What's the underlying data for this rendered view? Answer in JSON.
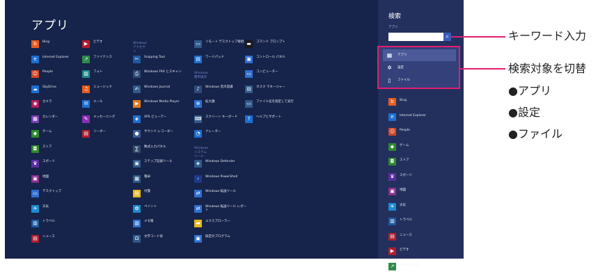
{
  "screen": {
    "title": "アプリ"
  },
  "columns": [
    [
      {
        "label": "Bing",
        "color": "#e65c1e",
        "icon": "b"
      },
      {
        "label": "Internet Explorer",
        "color": "#1e6fd0",
        "icon": "e"
      },
      {
        "label": "People",
        "color": "#d24726",
        "icon": "☺"
      },
      {
        "label": "SkyDrive",
        "color": "#1e6fd0",
        "icon": "☁"
      },
      {
        "label": "カメラ",
        "color": "#b01e5a",
        "icon": "◉"
      },
      {
        "label": "カレンダー",
        "color": "#7a3fb5",
        "icon": "▦"
      },
      {
        "label": "ゲーム",
        "color": "#2f8a2f",
        "icon": "◆"
      },
      {
        "label": "ストア",
        "color": "#2f8a2f",
        "icon": "◘"
      },
      {
        "label": "スポーツ",
        "color": "#5b2fa0",
        "icon": "♛"
      },
      {
        "label": "地図",
        "color": "#8a2f8a",
        "icon": "▣"
      },
      {
        "label": "デスクトップ",
        "color": "#2f6fd0",
        "icon": "▭"
      },
      {
        "label": "天気",
        "color": "#1e8ad0",
        "icon": "☀"
      },
      {
        "label": "トラベル",
        "color": "#1e5aa0",
        "icon": "▥"
      },
      {
        "label": "ニュース",
        "color": "#b01e2f",
        "icon": "▤"
      }
    ],
    [
      {
        "label": "ビデオ",
        "color": "#b01e2f",
        "icon": "▶"
      },
      {
        "label": "ファイナンス",
        "color": "#2f8a4a",
        "icon": "↗"
      },
      {
        "label": "フォト",
        "color": "#1e8a8a",
        "icon": "▨"
      },
      {
        "label": "ミュージック",
        "color": "#e65c1e",
        "icon": "♫"
      },
      {
        "label": "メール",
        "color": "#1e6fd0",
        "icon": "✉"
      },
      {
        "label": "メッセージング",
        "color": "#8a2fb0",
        "icon": "✎"
      },
      {
        "label": "リーダー",
        "color": "#b01e2f",
        "icon": "▤"
      }
    ],
    [
      {
        "header": "Windows アクセサリ"
      },
      {
        "label": "Snipping Tool",
        "color": "#1e5aa0",
        "icon": "✂"
      },
      {
        "label": "Windows FAX とスキャン",
        "color": "#2f4a7a",
        "icon": "⎙"
      },
      {
        "label": "Windows Journal",
        "color": "#2f5a8a",
        "icon": "✍"
      },
      {
        "label": "Windows Media Player",
        "color": "#e67a1e",
        "icon": "▶"
      },
      {
        "label": "XPS ビューアー",
        "color": "#1e6fd0",
        "icon": "◈"
      },
      {
        "label": "サウンド レコーダー",
        "color": "#3a5a9a",
        "icon": "●"
      },
      {
        "label": "数式入力パネル",
        "color": "#2f4a6a",
        "icon": "∑"
      },
      {
        "label": "ステップ記録ツール",
        "color": "#2f5a8a",
        "icon": "▣"
      },
      {
        "label": "電卓",
        "color": "#2f5a8a",
        "icon": "▦"
      },
      {
        "label": "付箋",
        "color": "#e6b81e",
        "icon": "▤"
      },
      {
        "label": "ペイント",
        "color": "#1e8ad0",
        "icon": "✿"
      },
      {
        "label": "メモ帳",
        "color": "#2f6fd0",
        "icon": "▥"
      },
      {
        "label": "文字コード表",
        "color": "#2f5a8a",
        "icon": "Ω"
      }
    ],
    [
      {
        "label": "リモート デスクトップ接続",
        "color": "#2f5a8a",
        "icon": "▭"
      },
      {
        "label": "ワードパッド",
        "color": "#1e6fd0",
        "icon": "▤"
      },
      {
        "header": "Windows 簡単操作"
      },
      {
        "label": "Windows 音声認識",
        "color": "#2f4a7a",
        "icon": "♪"
      },
      {
        "label": "拡大鏡",
        "color": "#2f6fd0",
        "icon": "⊕"
      },
      {
        "label": "スクリーン キーボード",
        "color": "#2f5a8a",
        "icon": "⌨"
      },
      {
        "label": "ナレーター",
        "color": "#1e6fd0",
        "icon": "◔"
      },
      {
        "header": "Windows システム ツール"
      },
      {
        "label": "Windows Defender",
        "color": "#2f5a8a",
        "icon": "◈"
      },
      {
        "label": "Windows PowerShell",
        "color": "#1e3a8a",
        "icon": "›"
      },
      {
        "label": "Windows 転送ツール",
        "color": "#2f6fd0",
        "icon": "⇄"
      },
      {
        "label": "Windows 転送ツール レポート",
        "color": "#2f6fd0",
        "icon": "⇄"
      },
      {
        "label": "エクスプローラー",
        "color": "#e6b81e",
        "icon": "▬"
      },
      {
        "label": "既定のプログラム",
        "color": "#2f6fd0",
        "icon": "▣"
      }
    ],
    [
      {
        "label": "コマンド プロンプト",
        "color": "#1a1a1a",
        "icon": "▬"
      },
      {
        "label": "コントロール パネル",
        "color": "#2f6fd0",
        "icon": "▣"
      },
      {
        "label": "コンピューター",
        "color": "#2f6fd0",
        "icon": "▭"
      },
      {
        "label": "タスク マネージャー",
        "color": "#2f5a8a",
        "icon": "▤"
      },
      {
        "label": "ファイル名を指定して実行",
        "color": "#2f5a8a",
        "icon": "▭"
      },
      {
        "label": "ヘルプとサポート",
        "color": "#1e6fd0",
        "icon": "?"
      }
    ]
  ],
  "charm": {
    "title": "検索",
    "scope": "アプリ",
    "search_value": "",
    "search_button_icon": "magnifier-icon",
    "filters": [
      {
        "label": "アプリ",
        "icon": "grid-icon",
        "selected": true
      },
      {
        "label": "設定",
        "icon": "gear-icon",
        "selected": false
      },
      {
        "label": "ファイル",
        "icon": "file-icon",
        "selected": false
      }
    ],
    "apps": [
      {
        "label": "Bing",
        "color": "#e65c1e",
        "icon": "b"
      },
      {
        "label": "Internet Explorer",
        "color": "#1e6fd0",
        "icon": "e"
      },
      {
        "label": "People",
        "color": "#d24726",
        "icon": "☺"
      },
      {
        "label": "ゲーム",
        "color": "#2f8a2f",
        "icon": "◆"
      },
      {
        "label": "ストア",
        "color": "#2f8a2f",
        "icon": "◘"
      },
      {
        "label": "スポーツ",
        "color": "#5b2fa0",
        "icon": "♛"
      },
      {
        "label": "地図",
        "color": "#8a2f8a",
        "icon": "▣"
      },
      {
        "label": "天気",
        "color": "#1e8ad0",
        "icon": "☀"
      },
      {
        "label": "トラベル",
        "color": "#1e5aa0",
        "icon": "▥"
      },
      {
        "label": "ニュース",
        "color": "#b01e2f",
        "icon": "▤"
      },
      {
        "label": "ビデオ",
        "color": "#b01e2f",
        "icon": "▶"
      },
      {
        "label": "ファイナンス",
        "color": "#2f8a4a",
        "icon": "↗"
      }
    ]
  },
  "annotations": {
    "keyword": "キーワード入力",
    "target": "検索対象を切替",
    "items": [
      "●アプリ",
      "●設定",
      "●ファイル"
    ],
    "accent_color": "#e61e6e"
  }
}
